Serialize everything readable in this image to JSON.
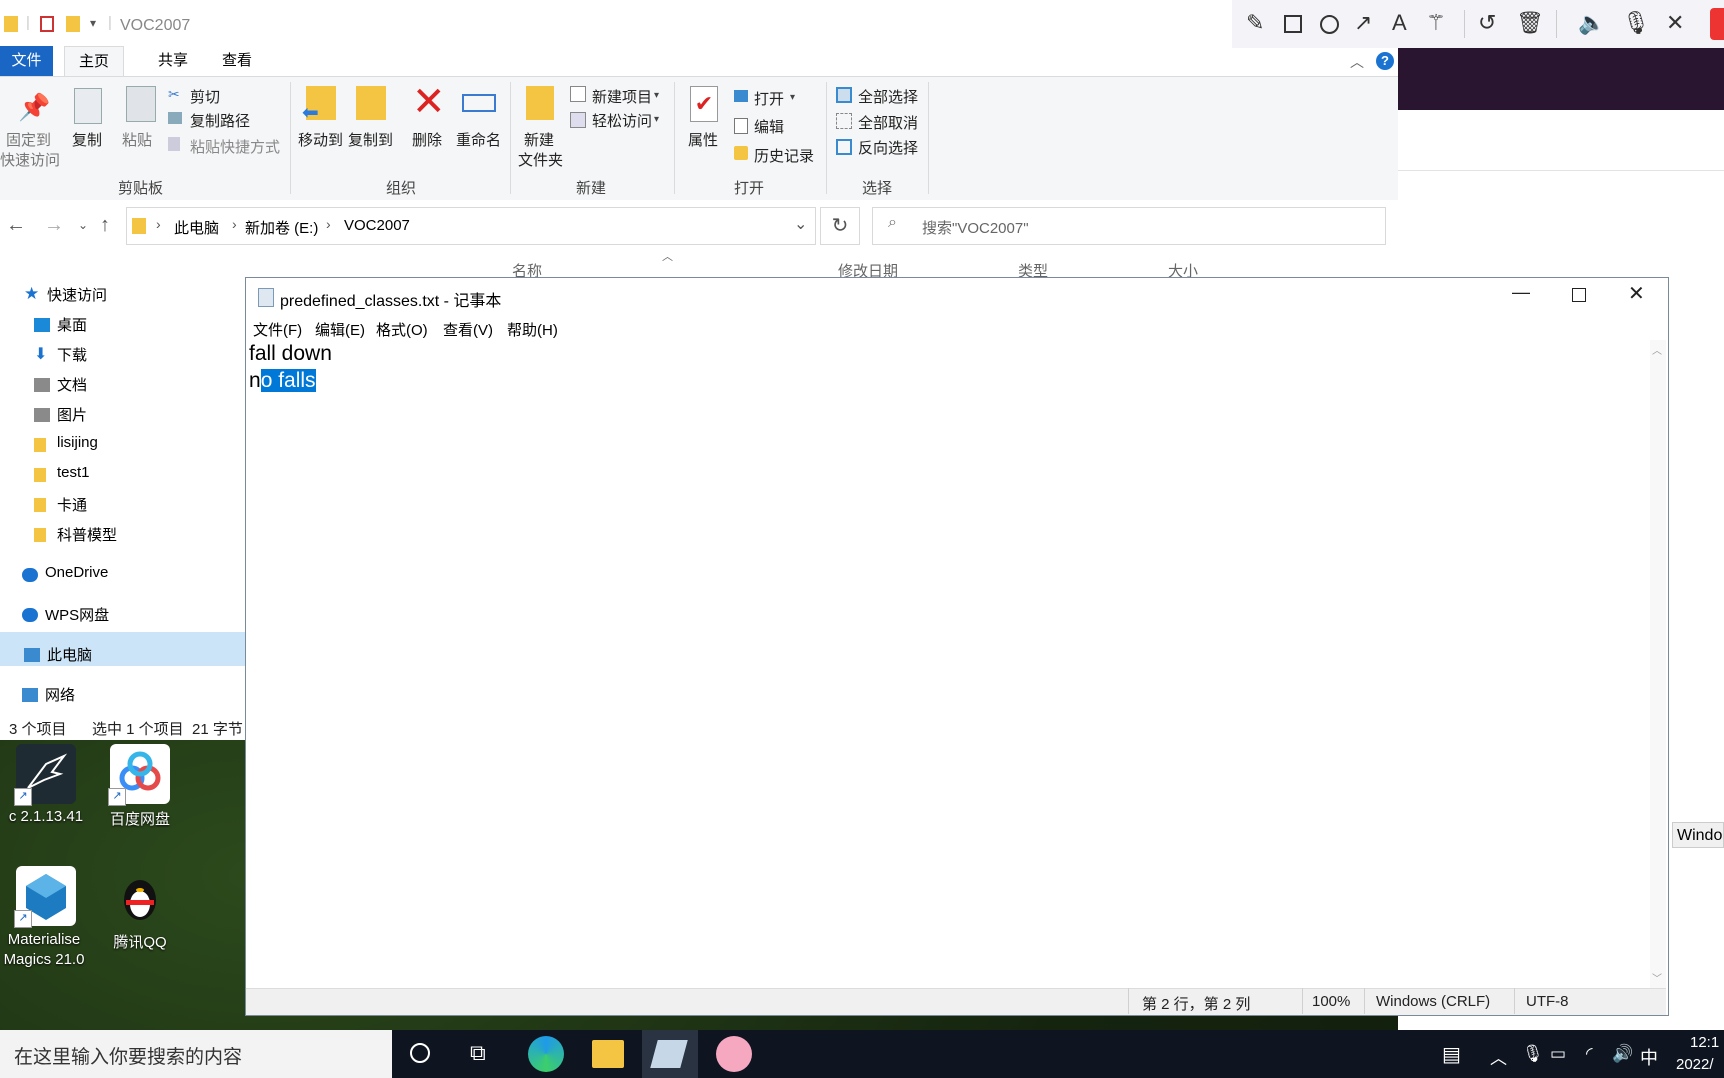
{
  "explorer": {
    "title": "VOC2007",
    "tabs": [
      "文件",
      "主页",
      "共享",
      "查看"
    ],
    "ribbon": {
      "clipboard": {
        "label": "剪贴板",
        "pin": "固定到",
        "pin2": "快速访问",
        "copy": "复制",
        "paste": "粘贴",
        "cut": "剪切",
        "copy_path": "复制路径",
        "paste_shortcut": "粘贴快捷方式"
      },
      "organize": {
        "label": "组织",
        "move_to": "移动到",
        "copy_to": "复制到",
        "delete": "删除",
        "rename": "重命名"
      },
      "new": {
        "label": "新建",
        "new_folder": "新建",
        "new_folder2": "文件夹",
        "new_item": "新建项目",
        "easy_access": "轻松访问"
      },
      "open": {
        "label": "打开",
        "properties": "属性",
        "open": "打开",
        "edit": "编辑",
        "history": "历史记录"
      },
      "select": {
        "label": "选择",
        "select_all": "全部选择",
        "select_none": "全部取消",
        "invert": "反向选择"
      }
    },
    "address": [
      "此电脑",
      "新加卷 (E:)",
      "VOC2007"
    ],
    "search_placeholder": "搜索\"VOC2007\"",
    "columns": [
      "名称",
      "修改日期",
      "类型",
      "大小"
    ],
    "sidebar": [
      {
        "label": "快速访问",
        "icon": "star-icon",
        "color": "#1a73d0"
      },
      {
        "label": "桌面",
        "icon": "desktop-icon",
        "color": "#1a8ad8"
      },
      {
        "label": "下载",
        "icon": "download-icon",
        "color": "#1a73d0"
      },
      {
        "label": "文档",
        "icon": "document-icon",
        "color": "#8a8a8a"
      },
      {
        "label": "图片",
        "icon": "pictures-icon",
        "color": "#8a8a8a"
      },
      {
        "label": "lisijing",
        "icon": "folder-icon",
        "color": "#f4c542"
      },
      {
        "label": "test1",
        "icon": "folder-icon",
        "color": "#f4c542"
      },
      {
        "label": "卡通",
        "icon": "folder-icon",
        "color": "#f4c542"
      },
      {
        "label": "科普模型",
        "icon": "folder-icon",
        "color": "#f4c542"
      },
      {
        "label": "OneDrive",
        "icon": "cloud-icon",
        "color": "#1a73d0"
      },
      {
        "label": "WPS网盘",
        "icon": "cloud-icon",
        "color": "#1a73d0"
      },
      {
        "label": "此电脑",
        "icon": "computer-icon",
        "color": "#3a8ad0"
      },
      {
        "label": "网络",
        "icon": "network-icon",
        "color": "#3a8ad0"
      }
    ],
    "status": {
      "count": "3 个项目",
      "selected": "选中 1 个项目",
      "size": "21 字节"
    }
  },
  "notepad": {
    "title": "predefined_classes.txt - 记事本",
    "menu": [
      "文件(F)",
      "编辑(E)",
      "格式(O)",
      "查看(V)",
      "帮助(H)"
    ],
    "line1": "fall down",
    "line2_pre": "n",
    "line2_sel": "o falls",
    "status": {
      "position": "第 2 行，第 2 列",
      "zoom": "100%",
      "eol": "Windows (CRLF)",
      "encoding": "UTF-8"
    }
  },
  "desktop": {
    "icons": [
      {
        "label": "c 2.1.13.41",
        "icon": "hummingbird-app-icon",
        "color": "#1e2b33"
      },
      {
        "label": "百度网盘",
        "icon": "baidu-netdisk-icon",
        "color": "#ffffff"
      },
      {
        "label": "Materialise",
        "label2": "Magics 21.0",
        "icon": "materialise-icon",
        "color": "#ffffff"
      },
      {
        "label": "腾讯QQ",
        "icon": "qq-icon",
        "color": "#000000"
      }
    ],
    "partial_window_tab": "Windo"
  },
  "taskbar": {
    "search_placeholder": "在这里输入你要搜索的内容",
    "ime": "中",
    "time": "12:1",
    "date": "2022/"
  },
  "colors": {
    "accent": "#0078d7",
    "file_tab": "#1a66c4",
    "ribbon_bg": "#f5f6f7"
  }
}
